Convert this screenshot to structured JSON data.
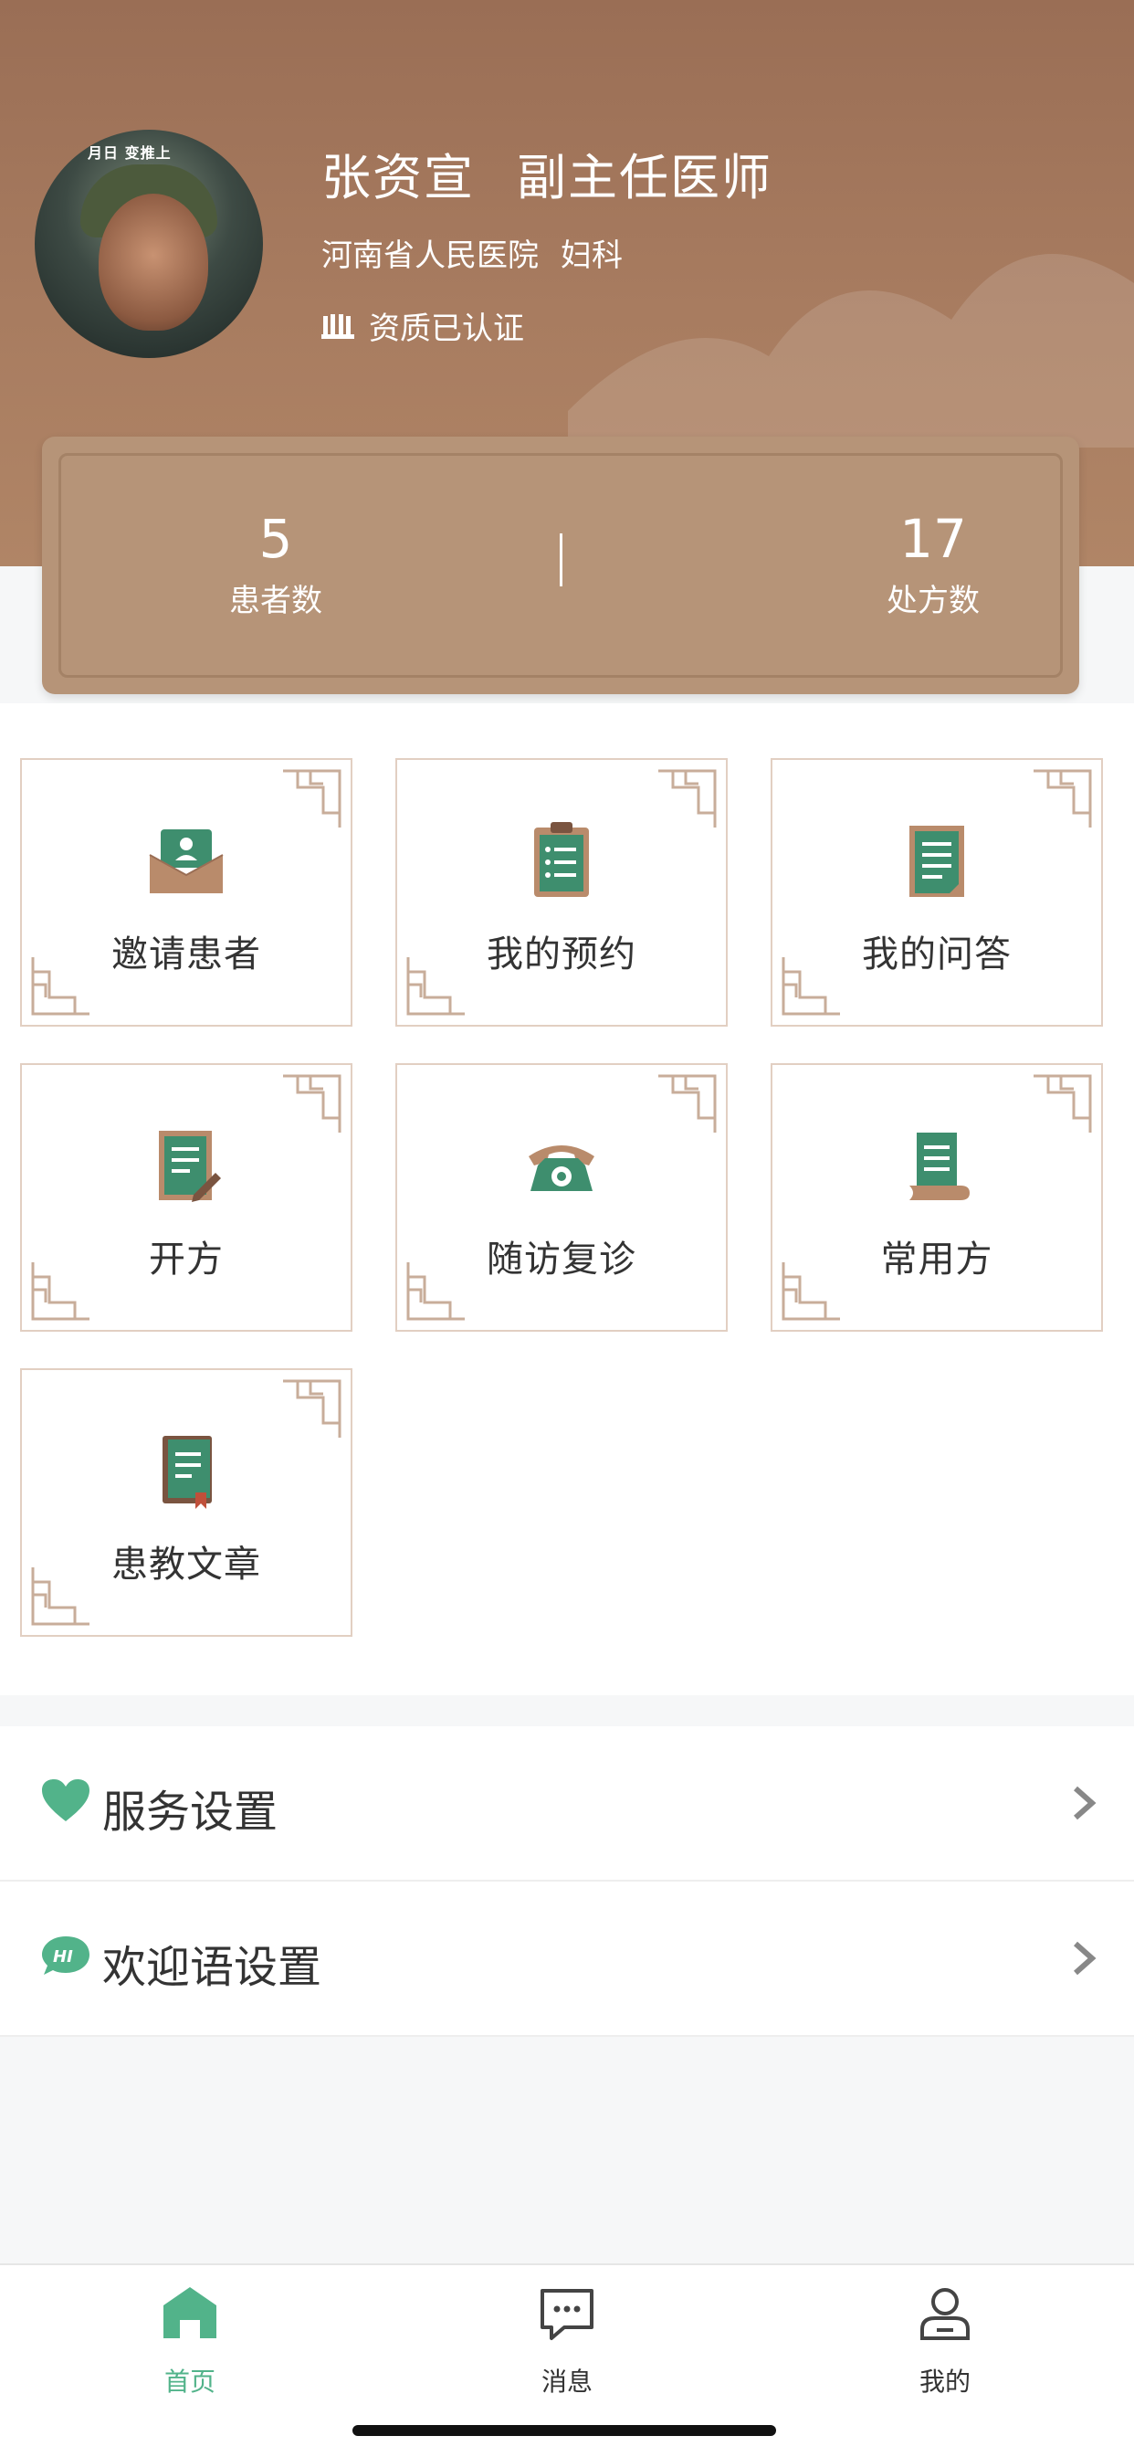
{
  "profile": {
    "name": "张资宣",
    "title": "副主任医师",
    "hospital": "河南省人民医院",
    "department": "妇科",
    "certified_text": "资质已认证",
    "avatar_caption": "月日 变推上"
  },
  "stats": {
    "patients": {
      "value": "5",
      "label": "患者数"
    },
    "prescriptions": {
      "value": "17",
      "label": "处方数"
    }
  },
  "tiles": [
    {
      "label": "邀请患者",
      "icon": "envelope-card-icon"
    },
    {
      "label": "我的预约",
      "icon": "clipboard-icon"
    },
    {
      "label": "我的问答",
      "icon": "document-icon"
    },
    {
      "label": "开方",
      "icon": "prescription-pen-icon"
    },
    {
      "label": "随访复诊",
      "icon": "telephone-icon"
    },
    {
      "label": "常用方",
      "icon": "scroll-icon"
    },
    {
      "label": "患教文章",
      "icon": "book-icon"
    }
  ],
  "settings": [
    {
      "label": "服务设置",
      "icon": "heart-icon"
    },
    {
      "label": "欢迎语设置",
      "icon": "hi-bubble-icon"
    }
  ],
  "tabbar": {
    "home": "首页",
    "messages": "消息",
    "me": "我的"
  },
  "colors": {
    "brand_brown": "#a87c60",
    "accent_green": "#52b38a",
    "icon_green": "#3e8e6e",
    "tile_border": "#e2cfc2"
  }
}
